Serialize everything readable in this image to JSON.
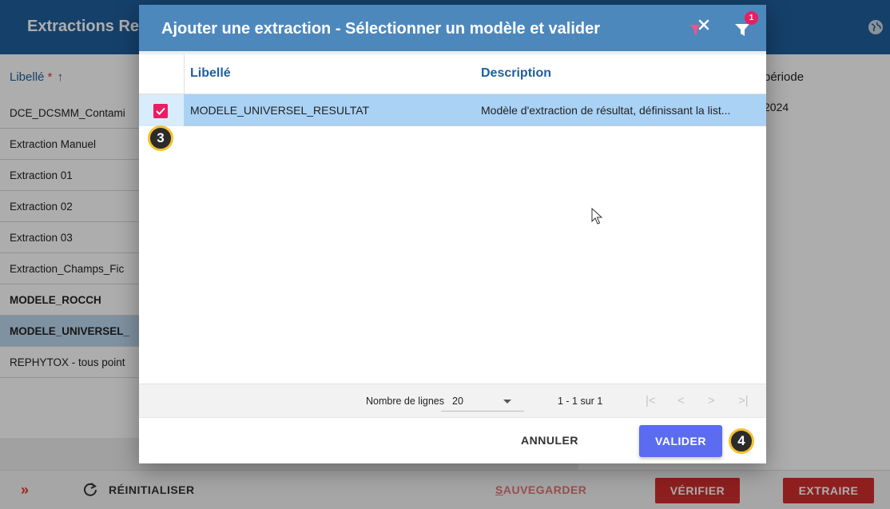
{
  "app": {
    "title": "Extractions Re",
    "list_header": {
      "label": "Libellé",
      "required": "*",
      "sort": "↑"
    },
    "list_items": [
      {
        "label": "DCE_DCSMM_Contami",
        "style": "normal"
      },
      {
        "label": "Extraction Manuel",
        "style": "normal"
      },
      {
        "label": "Extraction 01",
        "style": "normal"
      },
      {
        "label": "Extraction 02",
        "style": "normal"
      },
      {
        "label": "Extraction 03",
        "style": "normal"
      },
      {
        "label": "Extraction_Champs_Fic",
        "style": "normal"
      },
      {
        "label": "MODELE_ROCCH",
        "style": "bold"
      },
      {
        "label": "MODELE_UNIVERSEL_",
        "style": "selected"
      },
      {
        "label": "REPHYTOX - tous point",
        "style": "normal"
      }
    ],
    "right_header": "période",
    "right_cell": "2024",
    "bottom_bar": {
      "expand": "»",
      "reset": "RÉINITIALISER",
      "save_first": "S",
      "save_rest": "AUVEGARDER",
      "verify": "VÉRIFIER",
      "extract": "EXTRAIRE"
    }
  },
  "modal": {
    "title": "Ajouter une extraction - Sélectionner un modèle et valider",
    "filter_badge": "1",
    "columns": {
      "libelle": "Libellé",
      "description": "Description"
    },
    "rows": [
      {
        "checked": true,
        "libelle": "MODELE_UNIVERSEL_RESULTAT",
        "description": "Modèle d'extraction de résultat, définissant la list..."
      }
    ],
    "paginator": {
      "rows_label": "Nombre de lignes",
      "rows_value": "20",
      "range": "1 - 1 sur 1",
      "first": "|<",
      "prev": "<",
      "next": ">",
      "last": ">|"
    },
    "footer": {
      "cancel": "ANNULER",
      "validate": "VALIDER"
    }
  },
  "annotations": {
    "step3": "3",
    "step4": "4"
  },
  "colors": {
    "header": "#1f5f9c",
    "modal_header": "#4d88bd",
    "selected_row": "#a9d2f5",
    "checkbox": "#e91e63",
    "primary_button": "#5c6cf0",
    "danger_button": "#d32f2f"
  }
}
